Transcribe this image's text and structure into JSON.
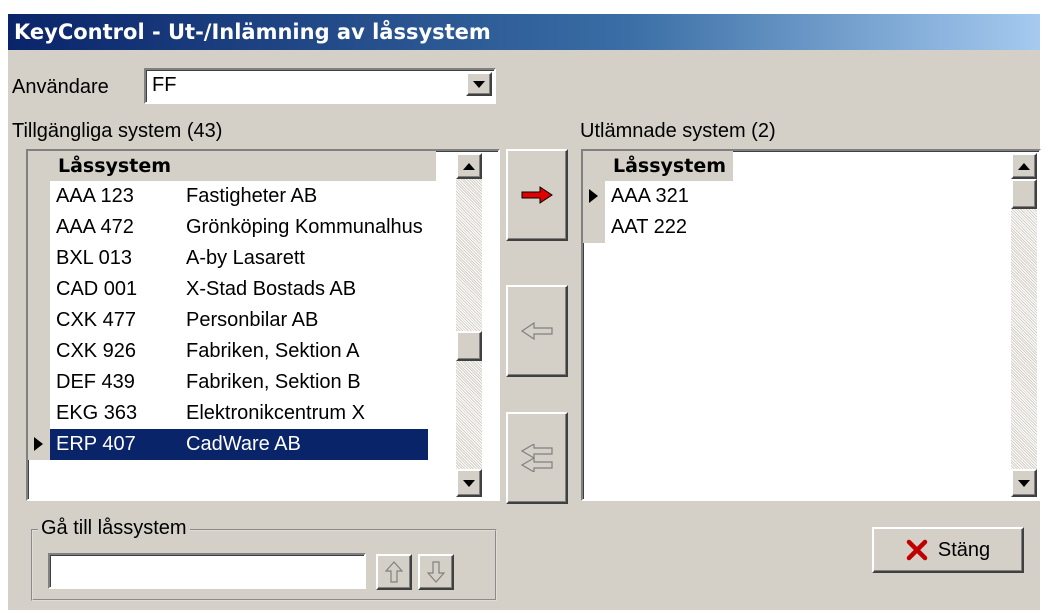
{
  "window": {
    "title": "KeyControl - Ut-/Inlämning av låssystem"
  },
  "user": {
    "label": "Användare",
    "value": "FF"
  },
  "available": {
    "label": "Tillgängliga system (43)",
    "header": "Låssystem",
    "rows": [
      {
        "code": "AAA 123",
        "name": "Fastigheter AB"
      },
      {
        "code": "AAA 472",
        "name": "Grönköping Kommunalhus"
      },
      {
        "code": "BXL 013",
        "name": "A-by Lasarett"
      },
      {
        "code": "CAD 001",
        "name": "X-Stad Bostads AB"
      },
      {
        "code": "CXK 477",
        "name": "Personbilar AB"
      },
      {
        "code": "CXK 926",
        "name": "Fabriken, Sektion A"
      },
      {
        "code": "DEF 439",
        "name": "Fabriken, Sektion B"
      },
      {
        "code": "EKG 363",
        "name": "Elektronikcentrum X"
      },
      {
        "code": "ERP 407",
        "name": "CadWare AB"
      }
    ],
    "selected_index": 8
  },
  "issued": {
    "label": "Utlämnade system (2)",
    "header": "Låssystem",
    "rows": [
      {
        "code": "AAA 321"
      },
      {
        "code": "AAT 222"
      }
    ],
    "current_index": 0
  },
  "goto": {
    "legend": "Gå till låssystem",
    "value": ""
  },
  "close_button": {
    "label": "Stäng"
  },
  "icons": {
    "move_right": "red-arrow-right-icon",
    "move_left": "arrow-left-icon",
    "move_all_left": "double-arrow-left-icon",
    "close": "red-x-icon",
    "up": "arrow-up-icon",
    "down": "arrow-down-icon"
  },
  "colors": {
    "selection": "#0a246a",
    "arrow_red": "#e00000",
    "face": "#d4d0c8"
  }
}
